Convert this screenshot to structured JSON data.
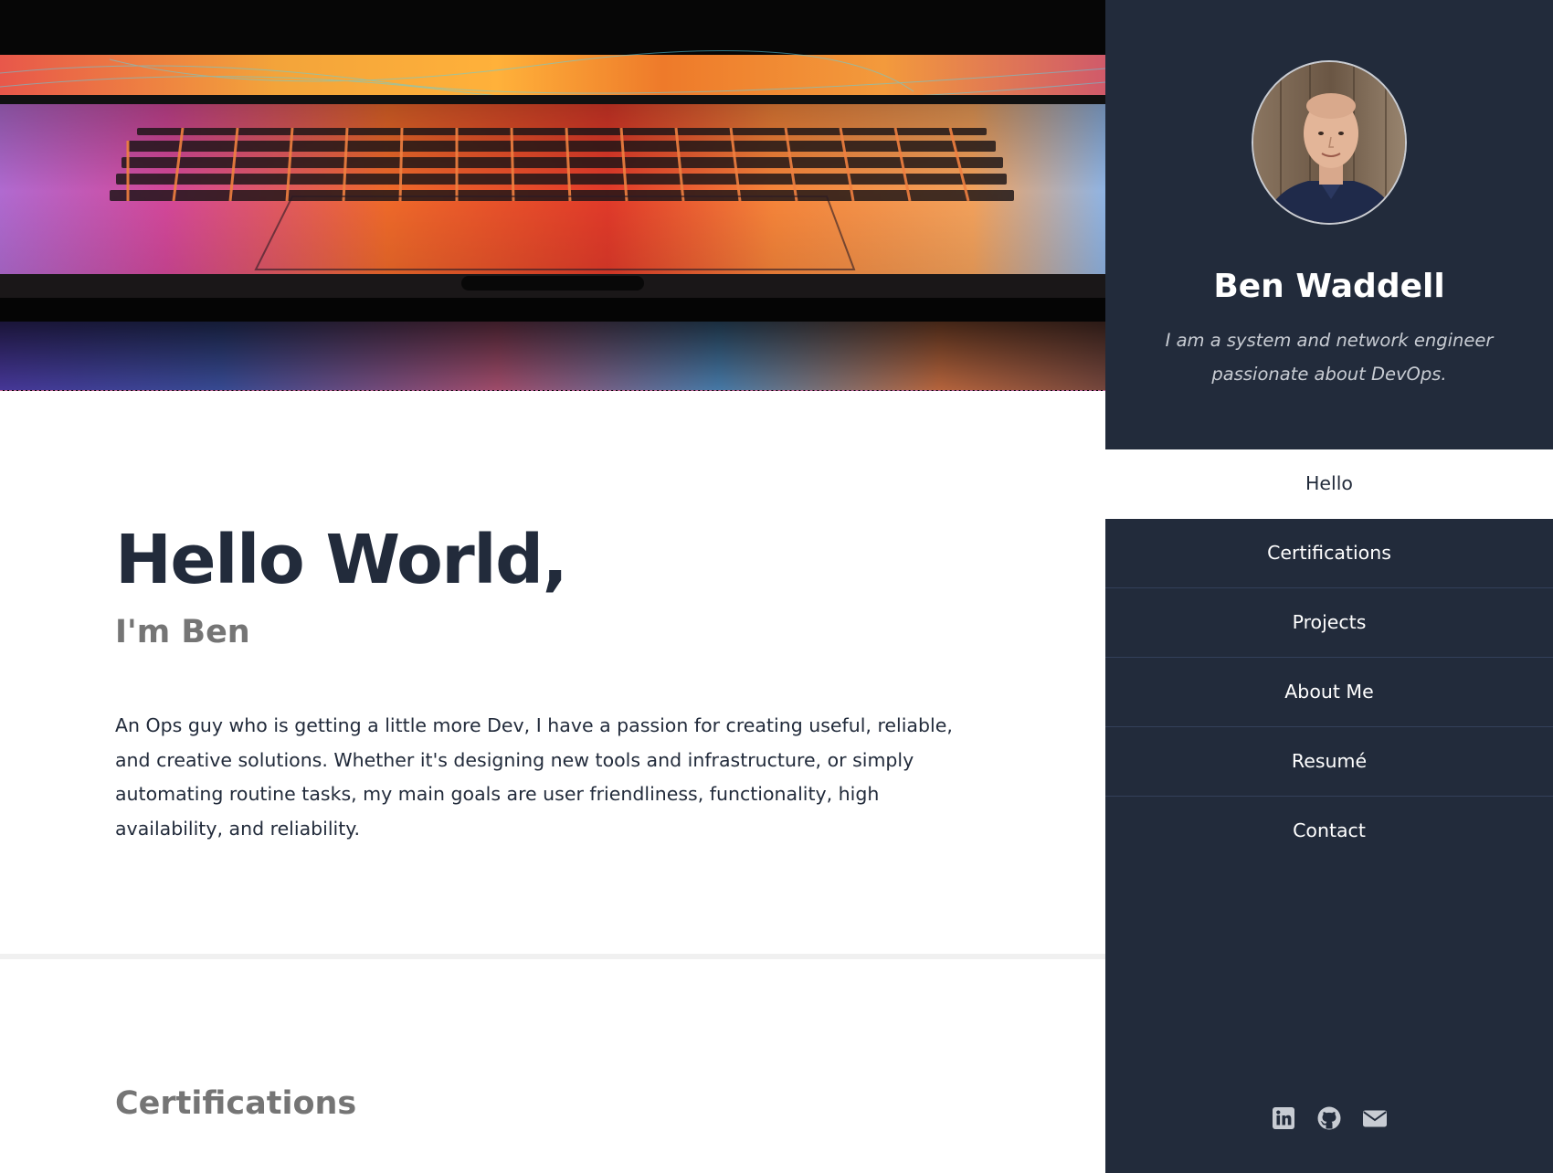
{
  "main": {
    "hello": {
      "title": "Hello World,",
      "subtitle": "I'm Ben",
      "body": "An Ops guy who is getting a little more Dev, I have a passion for creating useful, reliable, and creative solutions. Whether it's designing new tools and infrastructure, or simply automating routine tasks, my main goals are user friendliness, functionality, high availability, and reliability."
    },
    "certifications": {
      "heading": "Certifications"
    }
  },
  "sidebar": {
    "name": "Ben Waddell",
    "tagline": "I am a system and network engineer passionate about DevOps.",
    "nav": [
      {
        "label": "Hello",
        "active": true
      },
      {
        "label": "Certifications",
        "active": false
      },
      {
        "label": "Projects",
        "active": false
      },
      {
        "label": "About Me",
        "active": false
      },
      {
        "label": "Resumé",
        "active": false
      },
      {
        "label": "Contact",
        "active": false
      }
    ],
    "social": [
      {
        "icon": "linkedin-icon"
      },
      {
        "icon": "github-icon"
      },
      {
        "icon": "envelope-icon"
      }
    ]
  },
  "colors": {
    "sidebar_bg": "#222b3b",
    "heading_dark": "#222b3b",
    "heading_gray": "#757575",
    "nav_active_bg": "#ffffff",
    "social_icon": "#c8ccd3"
  }
}
